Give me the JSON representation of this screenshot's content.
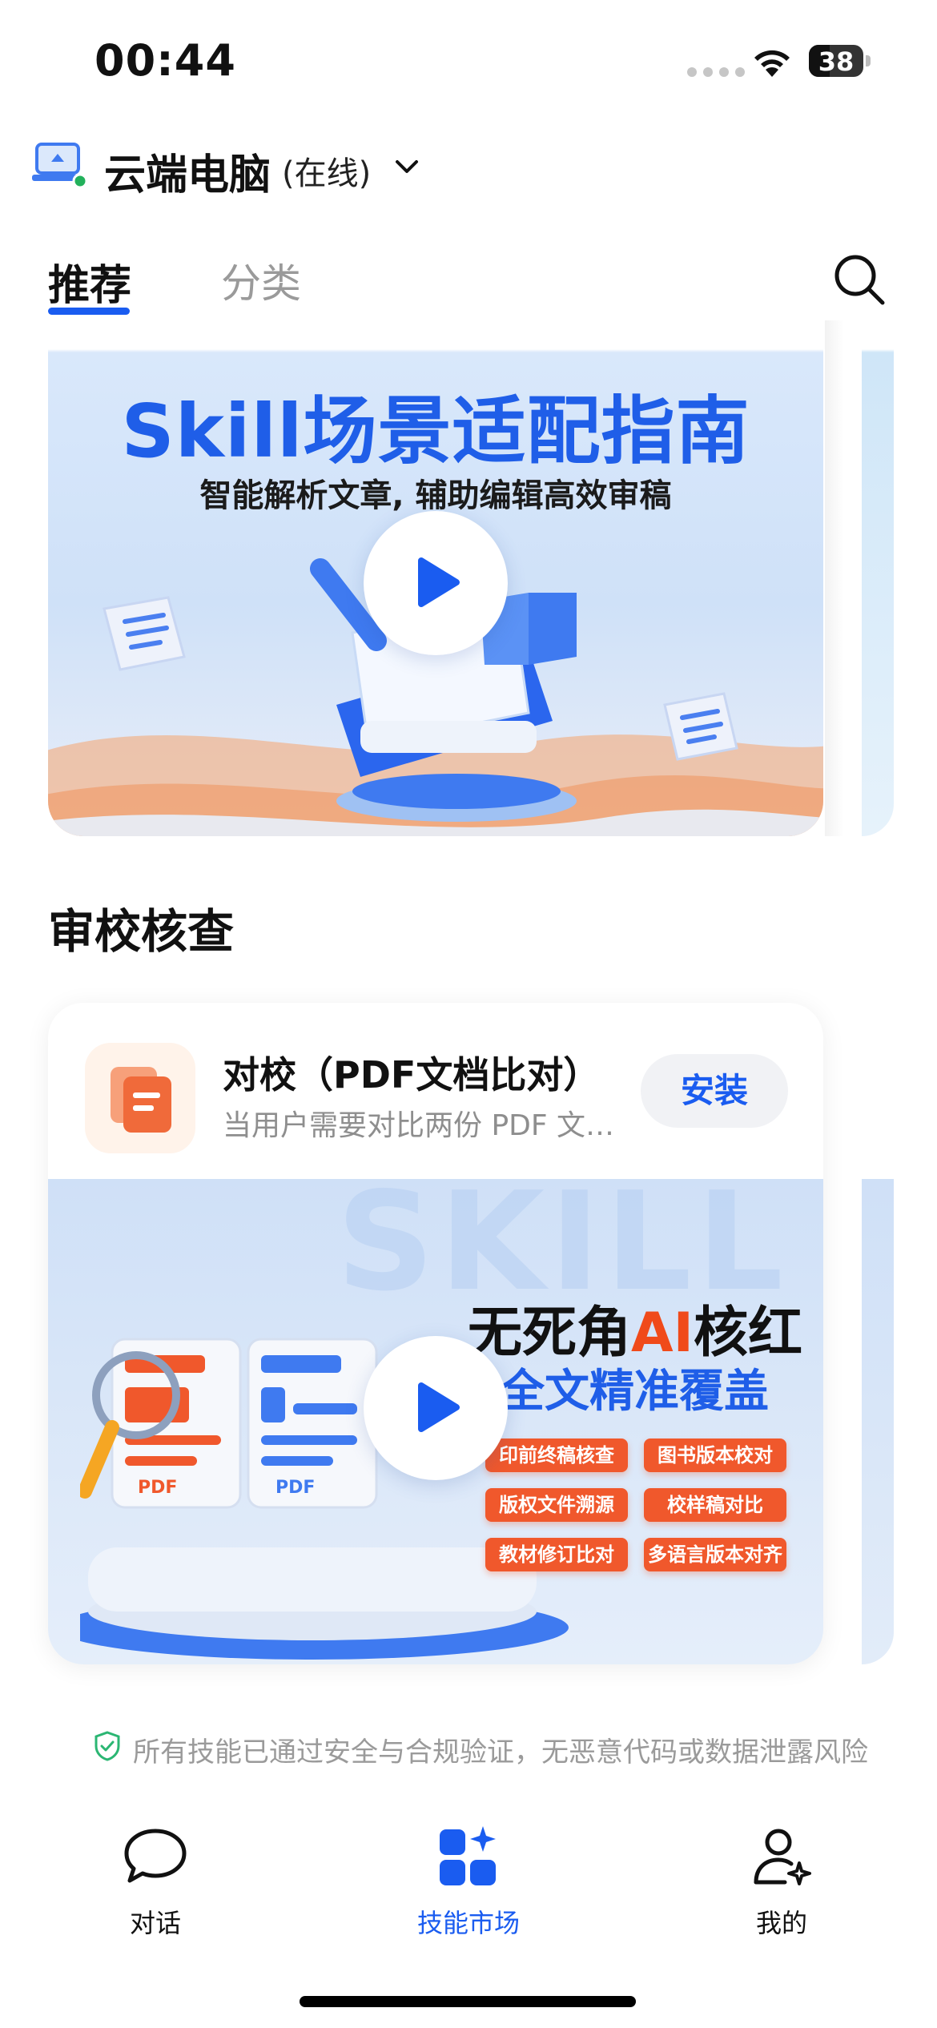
{
  "status_bar": {
    "time": "00:44",
    "battery_level": "38",
    "battery_fraction": 0.38
  },
  "device": {
    "name": "云端电脑",
    "status": "(在线)",
    "online_color": "#22b15b"
  },
  "tabs": [
    {
      "label": "推荐",
      "active": true
    },
    {
      "label": "分类",
      "active": false
    }
  ],
  "banner": {
    "title": "Skill场景适配指南",
    "subtitle": "智能解析文章, 辅助编辑高效审稿"
  },
  "section": {
    "title": "审校核查"
  },
  "skill_card": {
    "title": "对校（PDF文档比对）",
    "description": "当用户需要对比两份 PDF 文档时使用",
    "install_label": "安装",
    "media": {
      "bg_text": "SKILL",
      "headline_prefix": "无死角",
      "headline_ai": "AI",
      "headline_suffix": "核红",
      "subheadline": "全文精准覆盖",
      "doc_label": "PDF",
      "chips": [
        "印前终稿核查",
        "图书版本校对",
        "版权文件溯源",
        "校样稿对比",
        "教材修订比对",
        "多语言版本对齐"
      ]
    }
  },
  "notice": {
    "text": "所有技能已通过安全与合规验证，无恶意代码或数据泄露风险"
  },
  "nav": [
    {
      "label": "对话",
      "icon": "chat-bubble-icon",
      "active": false
    },
    {
      "label": "技能市场",
      "icon": "skill-market-icon",
      "active": true
    },
    {
      "label": "我的",
      "icon": "profile-icon",
      "active": false
    }
  ],
  "colors": {
    "accent": "#1a5cf0",
    "orange": "#f0582c"
  }
}
